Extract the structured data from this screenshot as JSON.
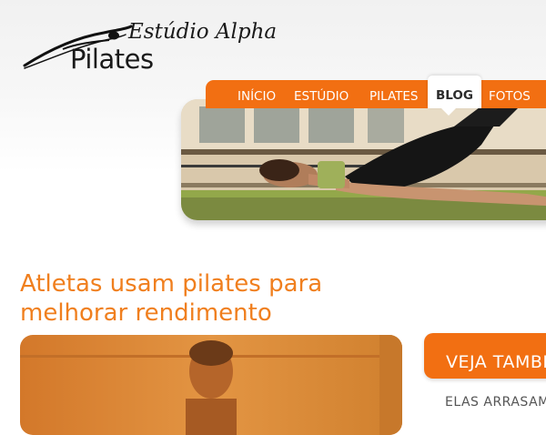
{
  "logo": {
    "line1": "Estúdio Alpha",
    "line2": "Pilates"
  },
  "nav": {
    "items": [
      {
        "label": "INÍCIO"
      },
      {
        "label": "ESTÚDIO"
      },
      {
        "label": "PILATES"
      },
      {
        "label": "BLOG",
        "active": true
      },
      {
        "label": "FOTOS"
      }
    ]
  },
  "article": {
    "title_line1": "Atletas usam pilates para",
    "title_line2": "melhorar rendimento"
  },
  "sidebar": {
    "title": "VEJA TAMBÉM",
    "link": "ELAS ARRASAM"
  },
  "colors": {
    "accent": "#f26f12",
    "title": "#f07f1e",
    "text": "#1a1a1a"
  }
}
